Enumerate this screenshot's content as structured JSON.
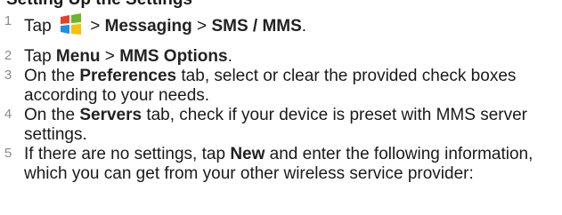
{
  "partial_heading": {
    "text": "Setting Up the Settings"
  },
  "steps": [
    {
      "number": "1",
      "pre": "Tap",
      "icon": "windows-start-icon",
      "post1": " > ",
      "b1": "Messaging",
      "post2": " > ",
      "b2": "SMS / MMS",
      "end": "."
    },
    {
      "number": "2",
      "pre": "Tap ",
      "b1": "Menu",
      "mid": " > ",
      "b2": "MMS Options",
      "end": "."
    },
    {
      "number": "3",
      "pre": "On the ",
      "b1": "Preferences",
      "end": " tab, select or clear the provided check boxes according to your needs."
    },
    {
      "number": "4",
      "pre": "On the ",
      "b1": "Servers",
      "end": " tab, check if your device is preset with MMS server settings."
    },
    {
      "number": "5",
      "pre": "If there are no settings, tap ",
      "b1": "New",
      "end": " and enter the following information, which you can get from your other wireless service provider:"
    }
  ],
  "colors": {
    "text": "#1a1a1a",
    "step_number": "#8a8a8a",
    "windows_red": "#e3412b",
    "windows_green": "#6fb42c",
    "windows_blue": "#1f8fe0",
    "windows_yellow": "#f7c20a"
  }
}
